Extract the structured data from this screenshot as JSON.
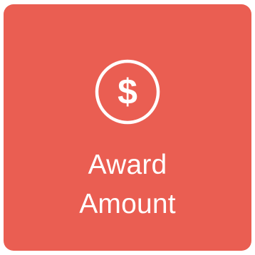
{
  "tile": {
    "label_line1": "Award",
    "label_line2": "Amount",
    "icon": "dollar-circle-icon",
    "colors": {
      "background": "#ea5e52",
      "foreground": "#ffffff"
    }
  }
}
